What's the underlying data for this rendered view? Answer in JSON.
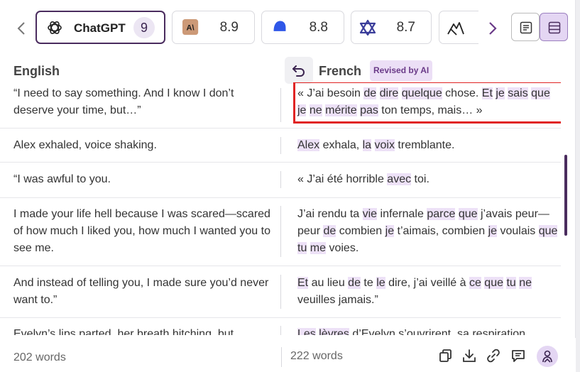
{
  "models": [
    {
      "name": "ChatGPT",
      "badge": "9",
      "logo": "openai-logo-icon",
      "active": true
    },
    {
      "name": "",
      "score": "8.9",
      "logo": "anthropic-logo-icon"
    },
    {
      "name": "",
      "score": "8.8",
      "logo": "blue-blob-logo-icon"
    },
    {
      "name": "",
      "score": "8.7",
      "logo": "triangle-logo-icon"
    },
    {
      "name": "",
      "score": "",
      "logo": "mountain-logo-icon"
    }
  ],
  "columns": {
    "source": "English",
    "target": "French",
    "revised_badge": "Revised by AI"
  },
  "rows": [
    {
      "source": "“I need to say something. And I know I don’t deserve your time, but…”",
      "target_segments": [
        {
          "t": "« J’ai besoin ",
          "h": false
        },
        {
          "t": "de",
          "h": true
        },
        {
          "t": " ",
          "h": false
        },
        {
          "t": "dire",
          "h": true
        },
        {
          "t": " ",
          "h": false
        },
        {
          "t": "quelque",
          "h": true
        },
        {
          "t": " chose. ",
          "h": false
        },
        {
          "t": "Et",
          "h": true
        },
        {
          "t": " ",
          "h": false
        },
        {
          "t": "je",
          "h": true
        },
        {
          "t": " ",
          "h": false
        },
        {
          "t": "sais",
          "h": true
        },
        {
          "t": " ",
          "h": false
        },
        {
          "t": "que",
          "h": true
        },
        {
          "t": " ",
          "h": false
        },
        {
          "t": "je",
          "h": true
        },
        {
          "t": " ",
          "h": false
        },
        {
          "t": "ne",
          "h": true
        },
        {
          "t": " ",
          "h": false
        },
        {
          "t": "mérite",
          "h": true
        },
        {
          "t": " ",
          "h": false
        },
        {
          "t": "pas",
          "h": true
        },
        {
          "t": " ton temps, mais… »",
          "h": false
        }
      ],
      "selected": true
    },
    {
      "source": "Alex exhaled, voice shaking.",
      "target_segments": [
        {
          "t": "Alex",
          "h": true
        },
        {
          "t": " exhala, ",
          "h": false
        },
        {
          "t": "la",
          "h": true
        },
        {
          "t": " ",
          "h": false
        },
        {
          "t": "voix",
          "h": true
        },
        {
          "t": " tremblante.",
          "h": false
        }
      ]
    },
    {
      "source": "“I was awful to you.",
      "target_segments": [
        {
          "t": "« J’ai été horrible ",
          "h": false
        },
        {
          "t": "avec",
          "h": true
        },
        {
          "t": " toi.",
          "h": false
        }
      ]
    },
    {
      "source": "I made your life hell because I was scared—scared of how much I liked you, how much I wanted you to see me.",
      "target_segments": [
        {
          "t": "J’ai rendu ta ",
          "h": false
        },
        {
          "t": "vie",
          "h": true
        },
        {
          "t": " infernale ",
          "h": false
        },
        {
          "t": "parce",
          "h": true
        },
        {
          "t": " ",
          "h": false
        },
        {
          "t": "que",
          "h": true
        },
        {
          "t": " j’avais peur—peur ",
          "h": false
        },
        {
          "t": "de",
          "h": true
        },
        {
          "t": " combien ",
          "h": false
        },
        {
          "t": "je",
          "h": true
        },
        {
          "t": " t’aimais, combien ",
          "h": false
        },
        {
          "t": "je",
          "h": true
        },
        {
          "t": " voulais ",
          "h": false
        },
        {
          "t": "que",
          "h": true
        },
        {
          "t": " ",
          "h": false
        },
        {
          "t": "tu",
          "h": true
        },
        {
          "t": " ",
          "h": false
        },
        {
          "t": "me",
          "h": true
        },
        {
          "t": " voies.",
          "h": false
        }
      ]
    },
    {
      "source": "And instead of telling you, I made sure you’d never want to.”",
      "target_segments": [
        {
          "t": "Et",
          "h": true
        },
        {
          "t": " au lieu ",
          "h": false
        },
        {
          "t": "de",
          "h": true
        },
        {
          "t": " te ",
          "h": false
        },
        {
          "t": "le",
          "h": true
        },
        {
          "t": " dire, j’ai veillé à ",
          "h": false
        },
        {
          "t": "ce",
          "h": true
        },
        {
          "t": " ",
          "h": false
        },
        {
          "t": "que",
          "h": true
        },
        {
          "t": " ",
          "h": false
        },
        {
          "t": "tu",
          "h": true
        },
        {
          "t": " ",
          "h": false
        },
        {
          "t": "ne",
          "h": true
        },
        {
          "t": " veuilles jamais.”",
          "h": false
        }
      ]
    },
    {
      "source": "Evelyn’s lips parted, her breath hitching, but",
      "target_segments": [
        {
          "t": "Les",
          "h": true
        },
        {
          "t": " ",
          "h": false
        },
        {
          "t": "lèvres",
          "h": true
        },
        {
          "t": " d’Evelyn s’ouvrirent, sa respiration",
          "h": false
        }
      ]
    }
  ],
  "footer": {
    "source_count": "202 words",
    "target_count": "222 words"
  },
  "icons": {
    "prev": "‹",
    "next": "›",
    "footer_icons": [
      "copy-icon",
      "download-icon",
      "link-icon",
      "comment-icon",
      "user-voice-icon"
    ]
  },
  "colors": {
    "accent": "#4a2c5e",
    "highlight": "#ede1f7",
    "selection": "#e02424"
  }
}
